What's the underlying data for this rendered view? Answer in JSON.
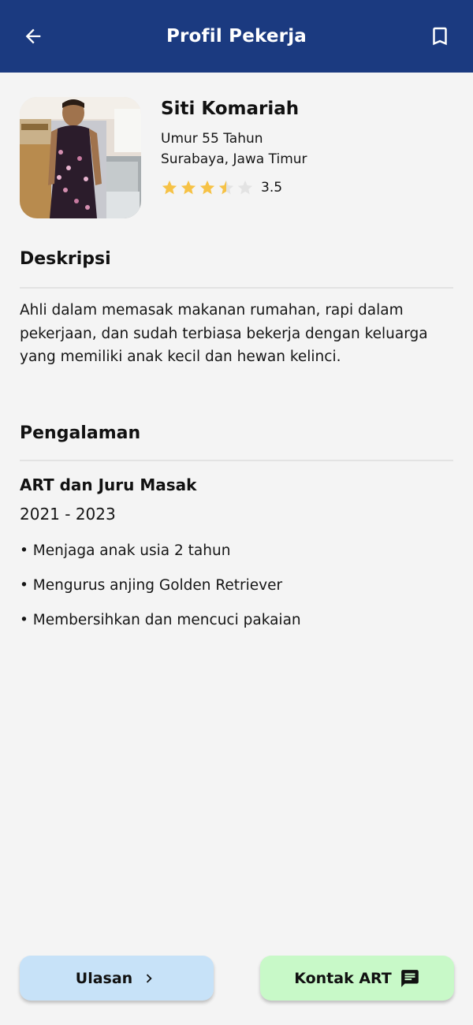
{
  "appbar": {
    "title": "Profil Pekerja",
    "back_icon": "arrow-back-icon",
    "bookmark_icon": "bookmark-icon",
    "background": "#1b3a80"
  },
  "profile": {
    "name": "Siti Komariah",
    "age": "Umur 55 Tahun",
    "location": "Surabaya, Jawa Timur",
    "rating": 3.5,
    "rating_text": "3.5",
    "star_color": "#f6c246",
    "star_empty_color": "#e3e3e3"
  },
  "description": {
    "title": "Deskripsi",
    "text": "Ahli dalam memasak makanan rumahan, rapi dalam pekerjaan, dan sudah terbiasa bekerja dengan keluarga yang memiliki anak kecil dan hewan kelinci."
  },
  "experience": {
    "title": "Pengalaman",
    "job_title": "ART dan Juru Masak",
    "years": "2021 - 2023",
    "tasks": [
      "• Menjaga anak usia 2 tahun",
      "• Mengurus anjing Golden Retriever",
      "• Membersihkan dan mencuci pakaian"
    ]
  },
  "buttons": {
    "review_label": "Ulasan",
    "review_icon": "chevron-right-icon",
    "review_color": "#c7e2f8",
    "contact_label": "Kontak ART",
    "contact_icon": "message-icon",
    "contact_color": "#c8f9c8"
  }
}
